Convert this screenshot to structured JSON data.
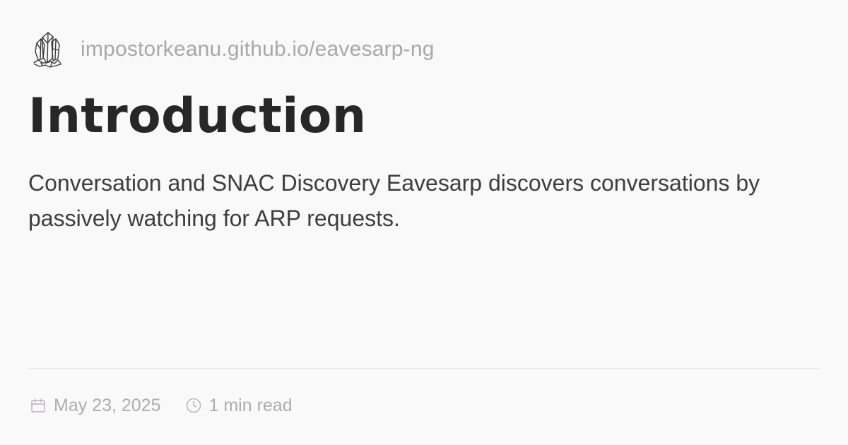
{
  "header": {
    "logo_icon": "crystal-cluster-icon",
    "site_url": "impostorkeanu.github.io/eavesarp-ng"
  },
  "article": {
    "title": "Introduction",
    "description": "Conversation and SNAC Discovery Eavesarp discovers conversations by passively watching for ARP requests."
  },
  "meta": {
    "date_icon": "calendar-icon",
    "date": "May 23, 2025",
    "read_time_icon": "clock-icon",
    "read_time": "1 min read"
  },
  "colors": {
    "background": "#faf9fa",
    "title": "#272727",
    "description": "#3d3d3d",
    "muted": "#aeacae",
    "divider": "#e6e4e7"
  }
}
